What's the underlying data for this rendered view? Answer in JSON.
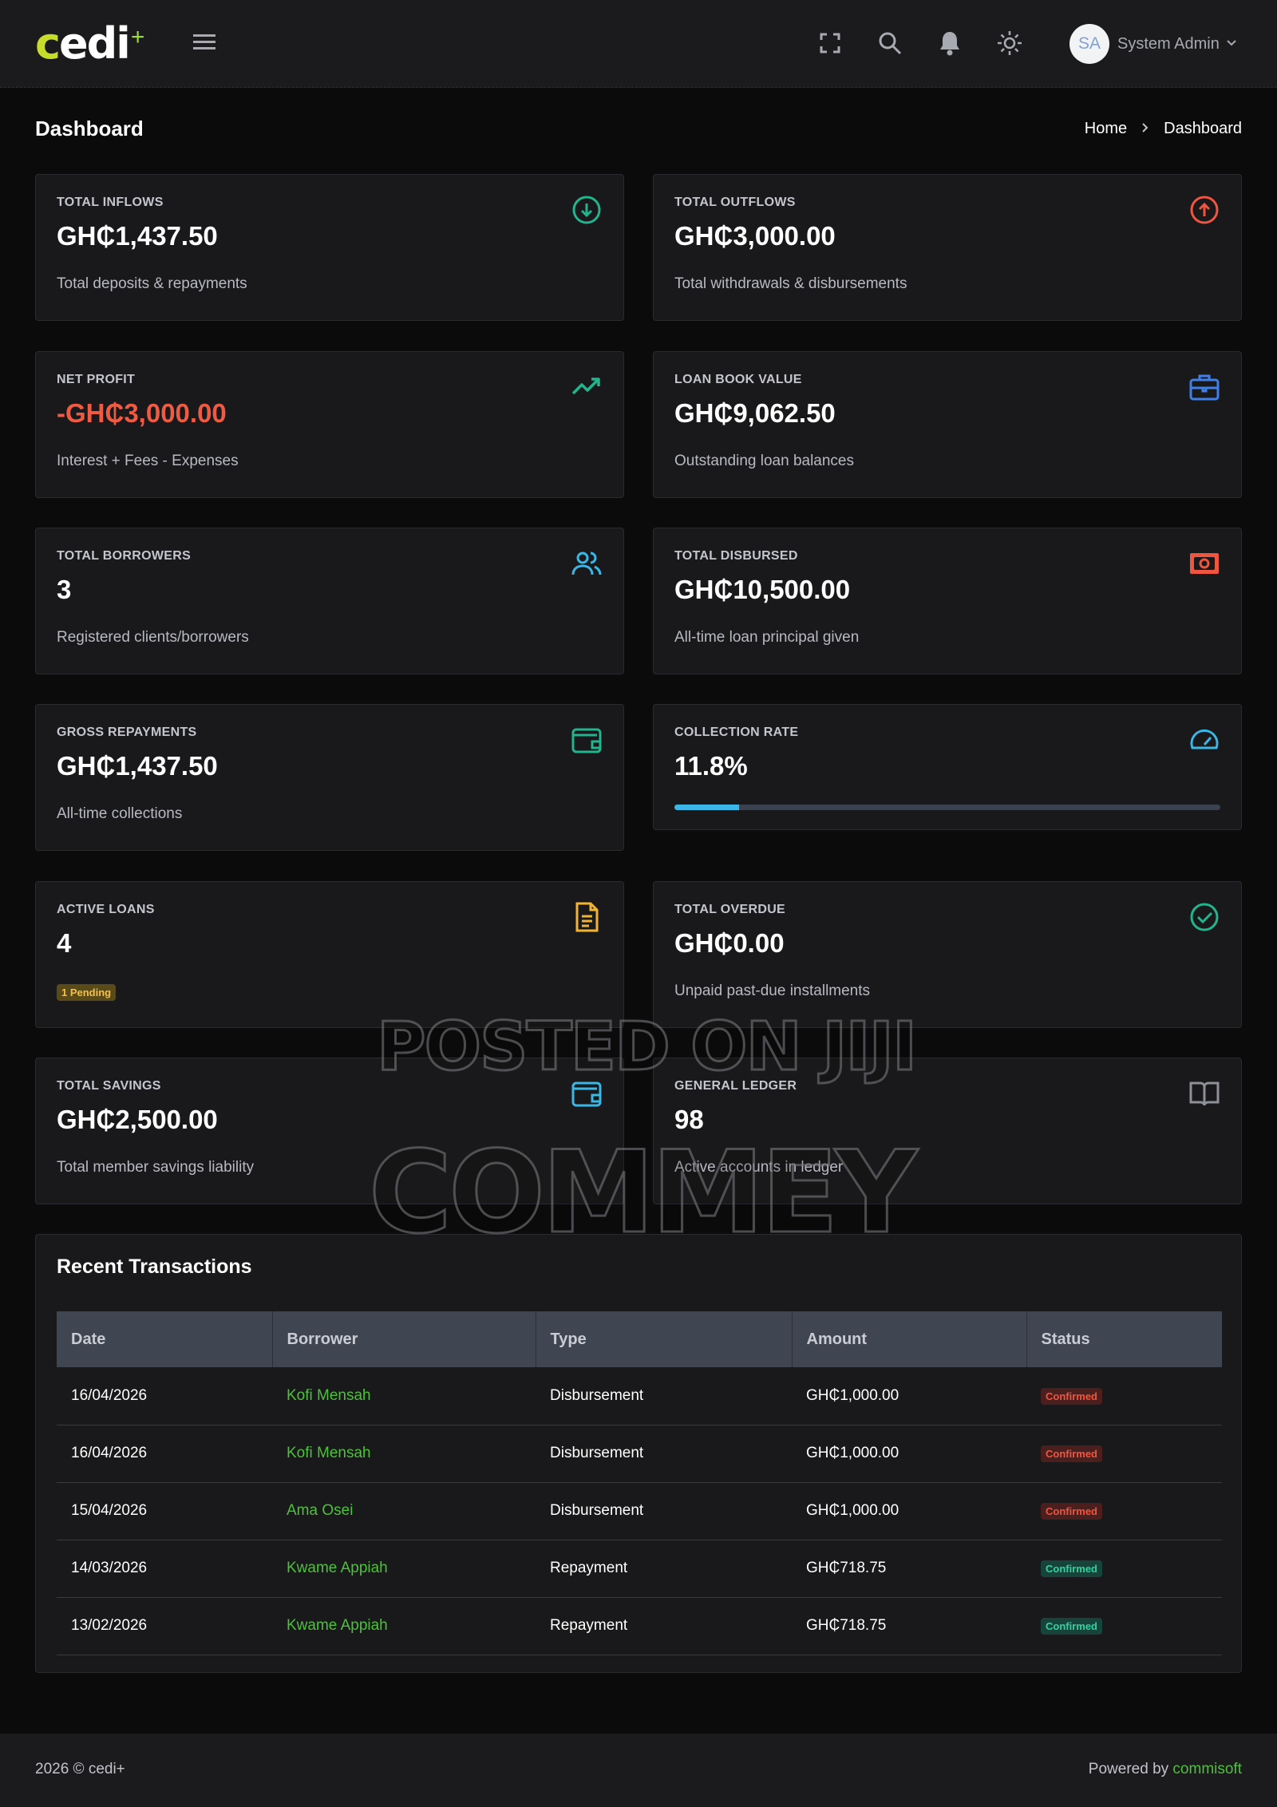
{
  "app": {
    "logo_c": "c",
    "logo_rest": "edi",
    "logo_plus": "+",
    "user_initials": "SA",
    "user_name": "System Admin"
  },
  "icons": {
    "menu": "hamburger-menu-icon",
    "fullscreen": "fullscreen-icon",
    "search": "search-icon",
    "notifications": "bell-icon",
    "theme": "sun-icon",
    "user_menu": "chevron-down-icon"
  },
  "page": {
    "title": "Dashboard",
    "breadcrumb": [
      "Home",
      "Dashboard"
    ]
  },
  "stats": [
    {
      "label": "TOTAL INFLOWS",
      "value": "GH₵1,437.50",
      "sub": "Total deposits & repayments",
      "icon": "arrow-down-circle-icon",
      "color": "#22b48c"
    },
    {
      "label": "TOTAL OUTFLOWS",
      "value": "GH₵3,000.00",
      "sub": "Total withdrawals & disbursements",
      "icon": "arrow-up-circle-icon",
      "color": "#f0553f"
    },
    {
      "label": "NET PROFIT",
      "value": "-GH₵3,000.00",
      "sub": "Interest + Fees - Expenses",
      "icon": "trending-up-icon",
      "color": "#22b48c"
    },
    {
      "label": "LOAN BOOK VALUE",
      "value": "GH₵9,062.50",
      "sub": "Outstanding loan balances",
      "icon": "briefcase-icon",
      "color": "#3f7fe8"
    },
    {
      "label": "TOTAL BORROWERS",
      "value": "3",
      "sub": "Registered clients/borrowers",
      "icon": "users-icon",
      "color": "#3ab7e6"
    },
    {
      "label": "TOTAL DISBURSED",
      "value": "GH₵10,500.00",
      "sub": "All-time loan principal given",
      "icon": "cash-icon",
      "color": "#f0553f"
    },
    {
      "label": "GROSS REPAYMENTS",
      "value": "GH₵1,437.50",
      "sub": "All-time collections",
      "icon": "wallet-icon",
      "color": "#22b48c"
    },
    {
      "label": "COLLECTION RATE",
      "value": "11.8%",
      "progress": 0.118,
      "icon": "gauge-icon",
      "color": "#3ab7e6"
    },
    {
      "label": "ACTIVE LOANS",
      "value": "4",
      "badge": "1 Pending",
      "icon": "document-icon",
      "color": "#f2b233"
    },
    {
      "label": "TOTAL OVERDUE",
      "value": "GH₵0.00",
      "sub": "Unpaid past-due installments",
      "icon": "check-circle-icon",
      "color": "#22b48c"
    },
    {
      "label": "TOTAL SAVINGS",
      "value": "GH₵2,500.00",
      "sub": "Total member savings liability",
      "icon": "wallet-icon",
      "color": "#3ab7e6"
    },
    {
      "label": "GENERAL LEDGER",
      "value": "98",
      "sub": "Active accounts in ledger",
      "icon": "book-open-icon",
      "color": "#8d9097"
    }
  ],
  "transactions": {
    "title": "Recent Transactions",
    "columns": [
      "Date",
      "Borrower",
      "Type",
      "Amount",
      "Status"
    ],
    "rows": [
      {
        "date": "16/04/2026",
        "borrower": "Kofi Mensah",
        "type": "Disbursement",
        "amount": "GH₵1,000.00",
        "status": "Confirmed",
        "status_color": "red"
      },
      {
        "date": "16/04/2026",
        "borrower": "Kofi Mensah",
        "type": "Disbursement",
        "amount": "GH₵1,000.00",
        "status": "Confirmed",
        "status_color": "red"
      },
      {
        "date": "15/04/2026",
        "borrower": "Ama Osei",
        "type": "Disbursement",
        "amount": "GH₵1,000.00",
        "status": "Confirmed",
        "status_color": "red"
      },
      {
        "date": "14/03/2026",
        "borrower": "Kwame Appiah",
        "type": "Repayment",
        "amount": "GH₵718.75",
        "status": "Confirmed",
        "status_color": "green"
      },
      {
        "date": "13/02/2026",
        "borrower": "Kwame Appiah",
        "type": "Repayment",
        "amount": "GH₵718.75",
        "status": "Confirmed",
        "status_color": "green"
      }
    ]
  },
  "footer": {
    "copyright": "2026 © cedi+",
    "powered_by": "Powered by ",
    "powered_link": "commisoft"
  },
  "watermark": {
    "line1": "POSTED ON JIJI",
    "line2": "COMMEY"
  }
}
